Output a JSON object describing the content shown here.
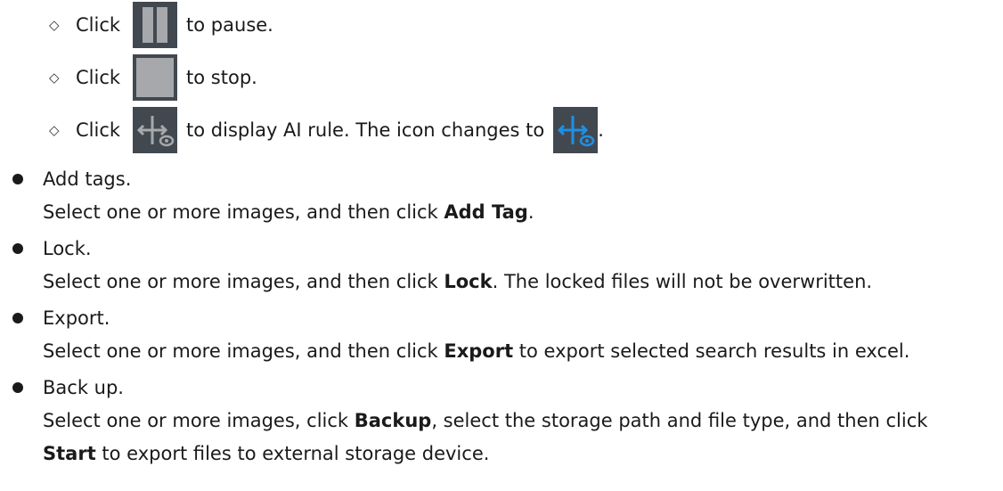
{
  "controls": [
    {
      "prefix": "Click",
      "icon": "pause-icon",
      "suffix": "to pause."
    },
    {
      "prefix": "Click",
      "icon": "stop-icon",
      "suffix": "to stop."
    },
    {
      "prefix": "Click",
      "icon": "ai-rule-icon",
      "suffix": "to display AI rule. The icon changes to",
      "end": "."
    }
  ],
  "items": [
    {
      "title": "Add tags.",
      "d1": "Select one or more images, and then click ",
      "b1": "Add Tag",
      "d2": "."
    },
    {
      "title": "Lock.",
      "d1": "Select one or more images, and then click ",
      "b1": "Lock",
      "d2": ". The locked files will not be overwritten."
    },
    {
      "title": "Export.",
      "d1": "Select one or more images, and then click ",
      "b1": "Export",
      "d2": " to export selected search results in excel."
    },
    {
      "title": "Back up.",
      "d1": "Select one or more images, click ",
      "b1": "Backup",
      "d2": ", select the storage path and file type, and then click",
      "b2": "Start",
      "d3": " to export files to external storage device."
    }
  ],
  "colors": {
    "icon_bg": "#42484f",
    "icon_gray": "#a6a8ab",
    "icon_blue": "#1e90e6"
  },
  "diamond_glyph": "◇"
}
